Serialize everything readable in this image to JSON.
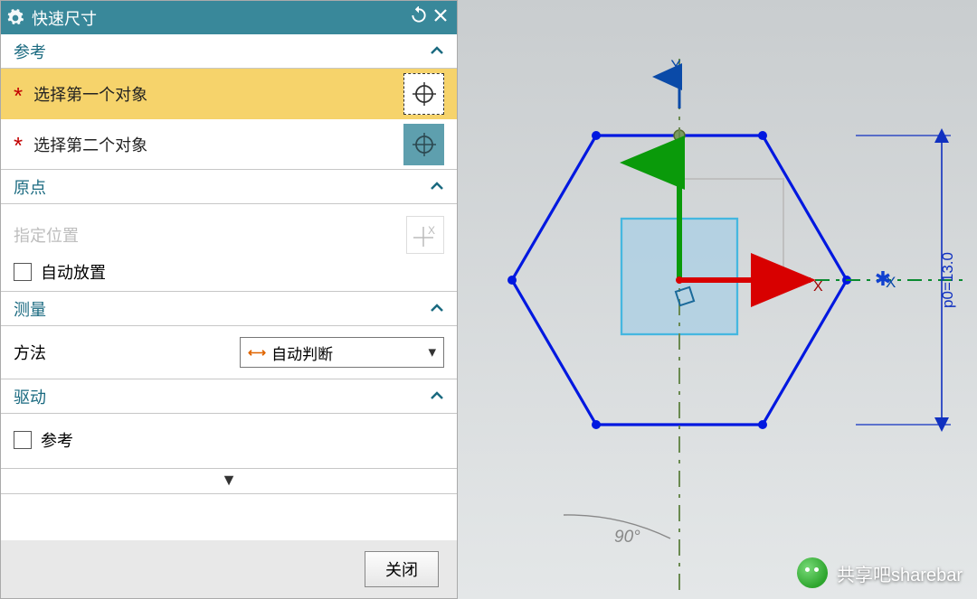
{
  "dialog": {
    "title": "快速尺寸",
    "sections": {
      "reference": {
        "header": "参考",
        "first_object": "选择第一个对象",
        "second_object": "选择第二个对象"
      },
      "origin": {
        "header": "原点",
        "specify_location": "指定位置",
        "auto_place": "自动放置"
      },
      "measure": {
        "header": "测量",
        "method_label": "方法",
        "method_value": "自动判断"
      },
      "drive": {
        "header": "驱动",
        "ref_checkbox": "参考"
      }
    },
    "close_button": "关闭"
  },
  "viewport": {
    "axis_y": "Y",
    "axis_x": "X",
    "axis_x2": "X",
    "angle_label": "90°",
    "dim_label": "p0=13.0"
  },
  "watermark": "共享吧sharebar"
}
